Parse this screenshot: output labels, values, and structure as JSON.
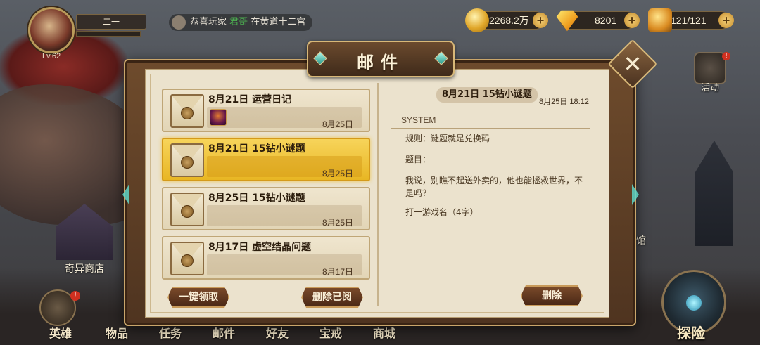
{
  "hud": {
    "player_name": "二一",
    "level": "Lv.62",
    "broadcast": {
      "prefix": "恭喜玩家",
      "player": "君哥",
      "suffix": "在黄道十二宫"
    },
    "gold": "2268.2万",
    "diamonds": "8201",
    "stamina": "121/121",
    "activity_label": "活动",
    "side_shop_label": "奇异商店",
    "side_right_label": "馆"
  },
  "mail_window": {
    "title": "邮件",
    "list": [
      {
        "title": "8月21日 运营日记",
        "date": "8月25日",
        "has_attachment": true,
        "selected": false
      },
      {
        "title": "8月21日 15钻小谜题",
        "date": "8月25日",
        "has_attachment": false,
        "selected": true
      },
      {
        "title": "8月25日 15钻小谜题",
        "date": "8月25日",
        "has_attachment": false,
        "selected": false
      },
      {
        "title": "8月17日 虚空结晶问题",
        "date": "8月17日",
        "has_attachment": false,
        "selected": false
      }
    ],
    "claim_all_label": "一键领取",
    "delete_read_label": "删除已阅",
    "delete_label": "删除",
    "detail": {
      "title": "8月21日 15钻小谜题",
      "time": "8月25日 18:12",
      "sender": "SYSTEM",
      "lines": [
        "规则：谜题就是兑换码",
        "题目：",
        "我说，别瞧不起送外卖的，他也能拯救世界，不是吗？",
        "打一游戏名（4字）"
      ]
    }
  },
  "bottom_nav": [
    "英雄",
    "物品",
    "任务",
    "邮件",
    "好友",
    "宝戒",
    "商城"
  ],
  "explore_label": "探险",
  "colors": {
    "selected_mail": "#f7d45a",
    "panel_border": "#c9a66b",
    "broadcast_name": "#4caf50"
  }
}
